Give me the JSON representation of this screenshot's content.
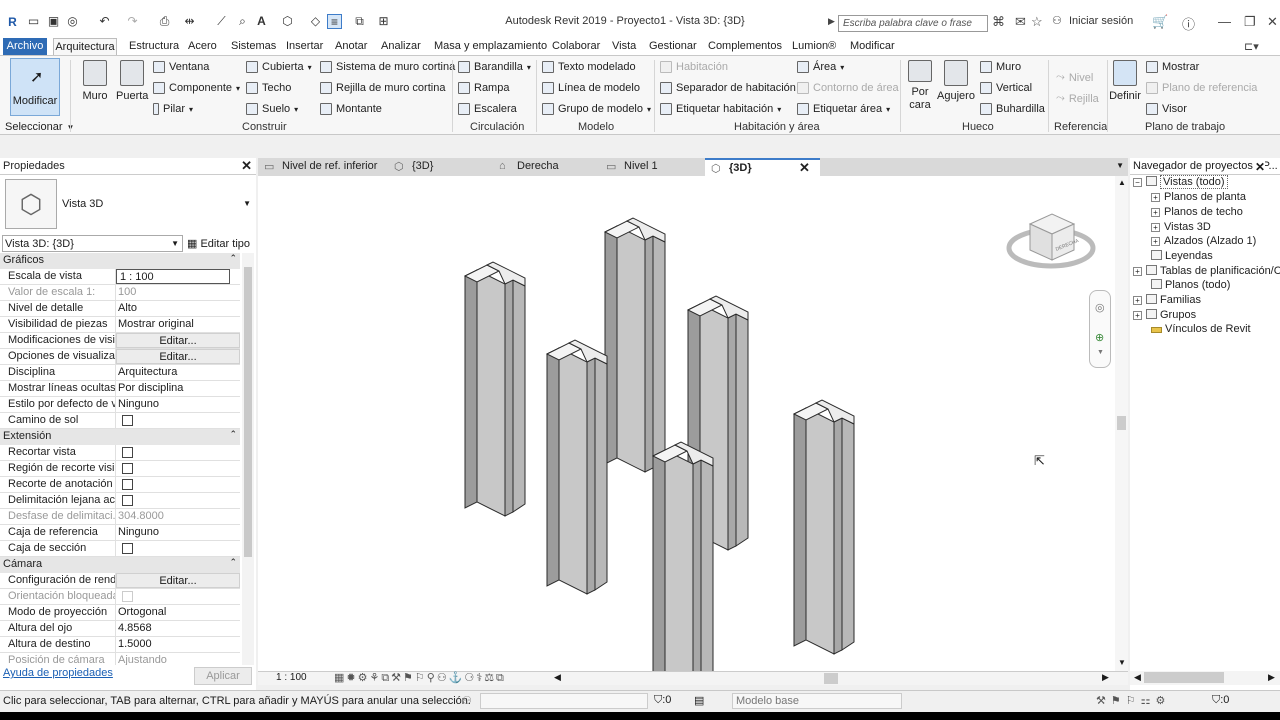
{
  "titlebar": {
    "title": "Autodesk Revit 2019 - Proyecto1 - Vista 3D: {3D}",
    "search_placeholder": "Escriba palabra clave o frase",
    "signin": "Iniciar sesión"
  },
  "menu": {
    "items": [
      "Archivo",
      "Arquitectura",
      "Estructura",
      "Acero",
      "Sistemas",
      "Insertar",
      "Anotar",
      "Analizar",
      "Masa y emplazamiento",
      "Colaborar",
      "Vista",
      "Gestionar",
      "Complementos",
      "Lumion®",
      "Modificar"
    ]
  },
  "ribbon": {
    "modificar": "Modificar",
    "seleccionar": "Seleccionar",
    "muro": "Muro",
    "puerta": "Puerta",
    "construir": {
      "ventana": "Ventana",
      "componente": "Componente",
      "pilar": "Pilar",
      "cubierta": "Cubierta",
      "techo": "Techo",
      "suelo": "Suelo",
      "sistema_muro": "Sistema de muro cortina",
      "rejilla_muro": "Rejilla de muro cortina",
      "montante": "Montante",
      "label": "Construir"
    },
    "circulacion": {
      "barandilla": "Barandilla",
      "rampa": "Rampa",
      "escalera": "Escalera",
      "label": "Circulación"
    },
    "modelo": {
      "texto": "Texto modelado",
      "linea": "Línea de modelo",
      "grupo": "Grupo de modelo",
      "label": "Modelo"
    },
    "habitacion": {
      "habitacion": "Habitación",
      "separador": "Separador de habitación",
      "etiquetar": "Etiquetar habitación",
      "area": "Área",
      "contorno": "Contorno de área",
      "etiquetar_area": "Etiquetar área",
      "label": "Habitación y área"
    },
    "hueco": {
      "por_cara": "Por cara",
      "agujero": "Agujero",
      "muro": "Muro",
      "vertical": "Vertical",
      "buhardilla": "Buhardilla",
      "label": "Hueco"
    },
    "referencia": {
      "nivel": "Nivel",
      "rejilla": "Rejilla",
      "label": "Referencia"
    },
    "plano": {
      "definir": "Definir",
      "mostrar": "Mostrar",
      "plano_ref": "Plano de referencia",
      "visor": "Visor",
      "label": "Plano de trabajo"
    }
  },
  "properties": {
    "title": "Propiedades",
    "type_name": "Vista 3D",
    "selector": "Vista 3D: {3D}",
    "edit_type": "Editar tipo",
    "groups": {
      "graficos": "Gráficos",
      "extension": "Extensión",
      "camara": "Cámara"
    },
    "rows": {
      "escala": [
        "Escala de vista",
        "1 : 100"
      ],
      "valor_escala": [
        "Valor de escala    1:",
        "100"
      ],
      "detalle": [
        "Nivel de detalle",
        "Alto"
      ],
      "visibilidad": [
        "Visibilidad de piezas",
        "Mostrar original"
      ],
      "modificaciones": [
        "Modificaciones de visi...",
        "Editar..."
      ],
      "opciones": [
        "Opciones de visualizac...",
        "Editar..."
      ],
      "disciplina": [
        "Disciplina",
        "Arquitectura"
      ],
      "lineas": [
        "Mostrar líneas ocultas",
        "Por disciplina"
      ],
      "estilo": [
        "Estilo por defecto de v...",
        "Ninguno"
      ],
      "sol": [
        "Camino de sol",
        ""
      ],
      "recortar": [
        "Recortar vista",
        ""
      ],
      "region": [
        "Región de recorte visi...",
        ""
      ],
      "anotacion": [
        "Recorte de anotación",
        ""
      ],
      "delimitacion": [
        "Delimitación lejana ac...",
        ""
      ],
      "desfase": [
        "Desfase de delimitaci...",
        "304.8000"
      ],
      "caja_ref": [
        "Caja de referencia",
        "Ninguno"
      ],
      "caja_seccion": [
        "Caja de sección",
        ""
      ],
      "config": [
        "Configuración de rend...",
        "Editar..."
      ],
      "orientacion": [
        "Orientación bloqueada",
        ""
      ],
      "proyeccion": [
        "Modo de proyección",
        "Ortogonal"
      ],
      "ojo": [
        "Altura del ojo",
        "4.8568"
      ],
      "destino": [
        "Altura de destino",
        "1.5000"
      ],
      "posicion": [
        "Posición de cámara",
        "Ajustando"
      ]
    },
    "help": "Ayuda de propiedades",
    "apply": "Aplicar"
  },
  "tabs": [
    {
      "label": "Nivel de ref. inferior"
    },
    {
      "label": "{3D}"
    },
    {
      "label": "Derecha"
    },
    {
      "label": "Nivel 1"
    },
    {
      "label": "{3D}"
    }
  ],
  "viewcube": {
    "face": "DERECHA"
  },
  "viewbar": {
    "scale": "1 : 100"
  },
  "navigator": {
    "title": "Navegador de proyectos - P...",
    "items": [
      "Vistas (todo)",
      "Planos de planta",
      "Planos de techo",
      "Vistas 3D",
      "Alzados (Alzado 1)",
      "Leyendas",
      "Tablas de planificación/C",
      "Planos (todo)",
      "Familias",
      "Grupos",
      "Vínculos de Revit"
    ]
  },
  "status": {
    "text": "Clic para seleccionar, TAB para alternar, CTRL para añadir y MAYÚS para anular una selección.",
    "count": ":0",
    "model": "Modelo base",
    "filter": ":0"
  }
}
